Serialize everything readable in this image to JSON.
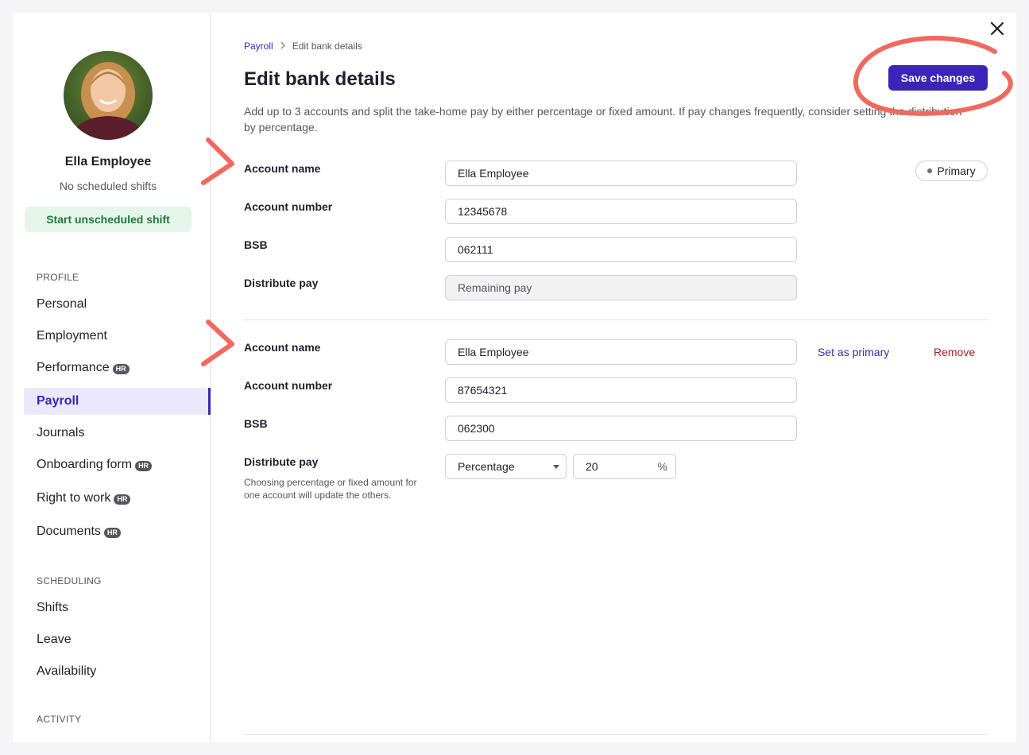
{
  "sidebar": {
    "profile": {
      "name": "Ella Employee",
      "status": "No scheduled shifts",
      "start_shift_label": "Start unscheduled shift"
    },
    "sections": [
      {
        "label": "PROFILE"
      },
      {
        "label": "SCHEDULING"
      },
      {
        "label": "ACTIVITY"
      }
    ],
    "items": [
      {
        "label": "Personal",
        "badge": ""
      },
      {
        "label": "Employment",
        "badge": ""
      },
      {
        "label": "Performance",
        "badge": "HR"
      },
      {
        "label": "Payroll",
        "badge": ""
      },
      {
        "label": "Journals",
        "badge": ""
      },
      {
        "label": "Onboarding form",
        "badge": "HR"
      },
      {
        "label": "Right to work",
        "badge": "HR"
      },
      {
        "label": "Documents",
        "badge": "HR"
      },
      {
        "label": "Shifts",
        "badge": ""
      },
      {
        "label": "Leave",
        "badge": ""
      },
      {
        "label": "Availability",
        "badge": ""
      }
    ],
    "active_item": "Payroll"
  },
  "header": {
    "breadcrumb": {
      "parent": "Payroll",
      "current": "Edit bank details"
    },
    "title": "Edit bank details",
    "save_label": "Save changes",
    "description": "Add up to 3 accounts and split the take-home pay by either percentage or fixed amount. If pay changes frequently, consider setting the distribution by percentage."
  },
  "accounts": [
    {
      "labels": {
        "name": "Account name",
        "number": "Account number",
        "bsb": "BSB",
        "distribute": "Distribute pay"
      },
      "name": "Ella Employee",
      "number": "12345678",
      "bsb": "062111",
      "distribute": "Remaining pay",
      "badge": "Primary"
    },
    {
      "labels": {
        "name": "Account name",
        "number": "Account number",
        "bsb": "BSB",
        "distribute": "Distribute pay"
      },
      "name": "Ella Employee",
      "number": "87654321",
      "bsb": "062300",
      "distribute_help": "Choosing percentage or fixed amount for one account will update the others.",
      "distribute_type": "Percentage",
      "distribute_value": "20",
      "distribute_unit": "%",
      "set_primary_label": "Set as primary",
      "remove_label": "Remove"
    }
  ],
  "colors": {
    "accent": "#3b25b8",
    "annotation": "#f0695f",
    "success_bg": "#e6f5ea",
    "success_text": "#1f7a3a",
    "danger": "#a51d1d"
  }
}
